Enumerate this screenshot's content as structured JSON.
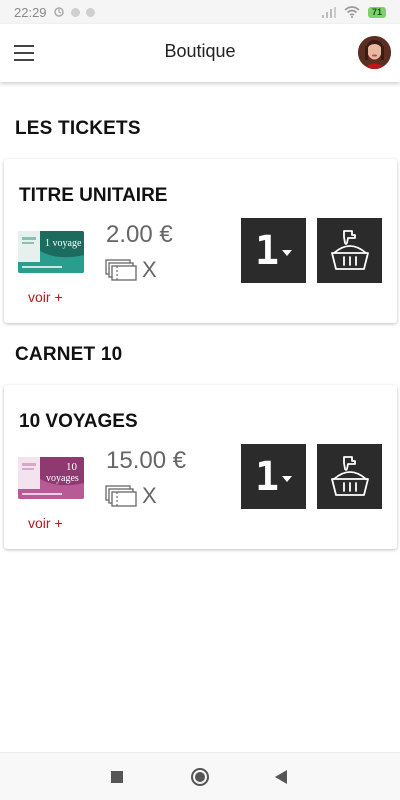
{
  "status_bar": {
    "time": "22:29",
    "battery": "71"
  },
  "app_bar": {
    "title": "Boutique"
  },
  "sections": [
    {
      "title": "LES TICKETS",
      "product": {
        "name": "TITRE UNITAIRE",
        "image_text": "1 voyage",
        "image_color": "#2a9e8e",
        "price": "2.00 €",
        "quantity_label": "X",
        "more_link": "voir +",
        "quantity": "1"
      }
    },
    {
      "title": "CARNET 10",
      "product": {
        "name": "10 VOYAGES",
        "image_text_top": "10",
        "image_text_bottom": "voyages",
        "image_color": "#b85a96",
        "price": "15.00 €",
        "quantity_label": "X",
        "more_link": "voir +",
        "quantity": "1"
      }
    }
  ],
  "colors": {
    "accent_link": "#b31b1b",
    "button_bg": "#2b2b2b"
  },
  "icons": {
    "menu": "hamburger-menu-icon",
    "cart": "basket-add-icon",
    "tickets": "tickets-stack-icon"
  }
}
